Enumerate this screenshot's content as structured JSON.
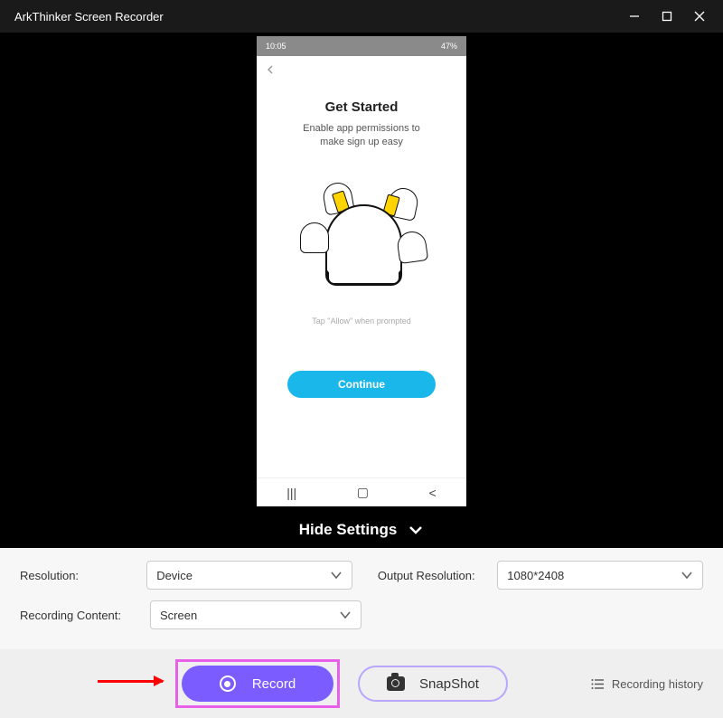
{
  "titleBar": {
    "title": "ArkThinker Screen Recorder"
  },
  "phone": {
    "statusTime": "10:05",
    "statusBattery": "47%",
    "heading": "Get Started",
    "sub1": "Enable app permissions to",
    "sub2": "make sign up easy",
    "hint": "Tap \"Allow\" when prompted",
    "continue": "Continue"
  },
  "hideSettings": "Hide Settings",
  "settings": {
    "resolutionLabel": "Resolution:",
    "resolutionValue": "Device",
    "outputResLabel": "Output Resolution:",
    "outputResValue": "1080*2408",
    "recContentLabel": "Recording Content:",
    "recContentValue": "Screen"
  },
  "actions": {
    "record": "Record",
    "snapshot": "SnapShot",
    "history": "Recording history"
  }
}
